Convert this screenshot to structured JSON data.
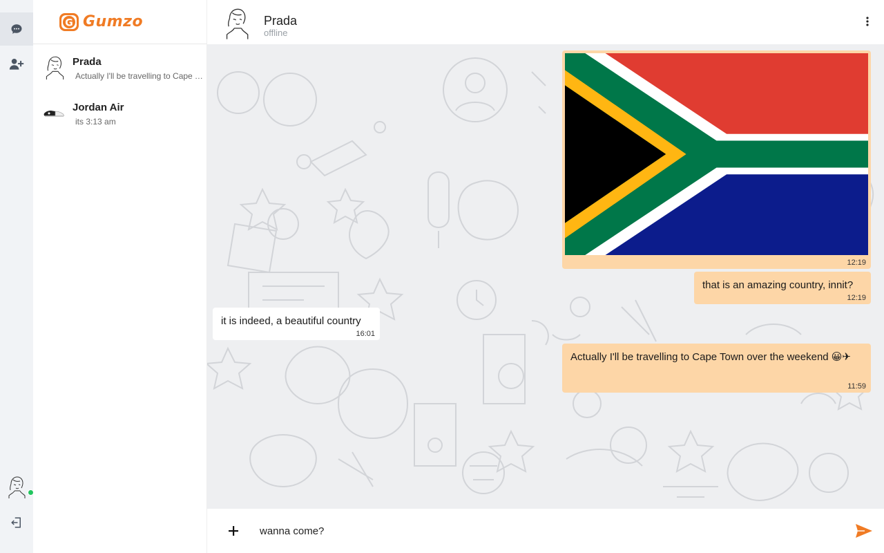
{
  "app": {
    "name": "Gumzo",
    "logo_letter": "G",
    "accent_color": "#f07b24",
    "online_color": "#22c55e"
  },
  "rail": {
    "items": [
      {
        "id": "chats",
        "icon": "chat-bubble-icon",
        "active": true
      },
      {
        "id": "add-contact",
        "icon": "user-plus-icon",
        "active": false
      }
    ],
    "user_avatar_icon": "sketch-avatar-icon",
    "logout_icon": "logout-icon"
  },
  "sidebar": {
    "chats": [
      {
        "name": "Prada",
        "preview": "Actually I'll be travelling to Cape Town over the weekend",
        "avatar_icon": "sketch-avatar-icon"
      },
      {
        "name": "Jordan Air",
        "preview": "its 3:13 am",
        "avatar_icon": "sneaker-avatar-icon"
      }
    ]
  },
  "header": {
    "name": "Prada",
    "status": "offline",
    "menu_icon": "kebab-menu-icon"
  },
  "messages": [
    {
      "type": "image",
      "direction": "out",
      "image": "south-africa-flag",
      "time": "12:19"
    },
    {
      "type": "text",
      "direction": "out",
      "text": "that is an amazing country, innit?",
      "time": "12:19"
    },
    {
      "type": "text",
      "direction": "in",
      "text": "it is indeed, a beautiful country",
      "time": "16:01"
    },
    {
      "type": "text",
      "direction": "out",
      "text": "Actually I'll be travelling to Cape Town over the weekend 😀✈",
      "time": "11:59"
    }
  ],
  "composer": {
    "value": "wanna come?",
    "attach_icon": "plus-icon",
    "send_icon": "send-icon"
  },
  "colors": {
    "outgoing_bubble": "#fdd6a7",
    "incoming_bubble": "#ffffff",
    "chat_background": "#eeeff1"
  }
}
